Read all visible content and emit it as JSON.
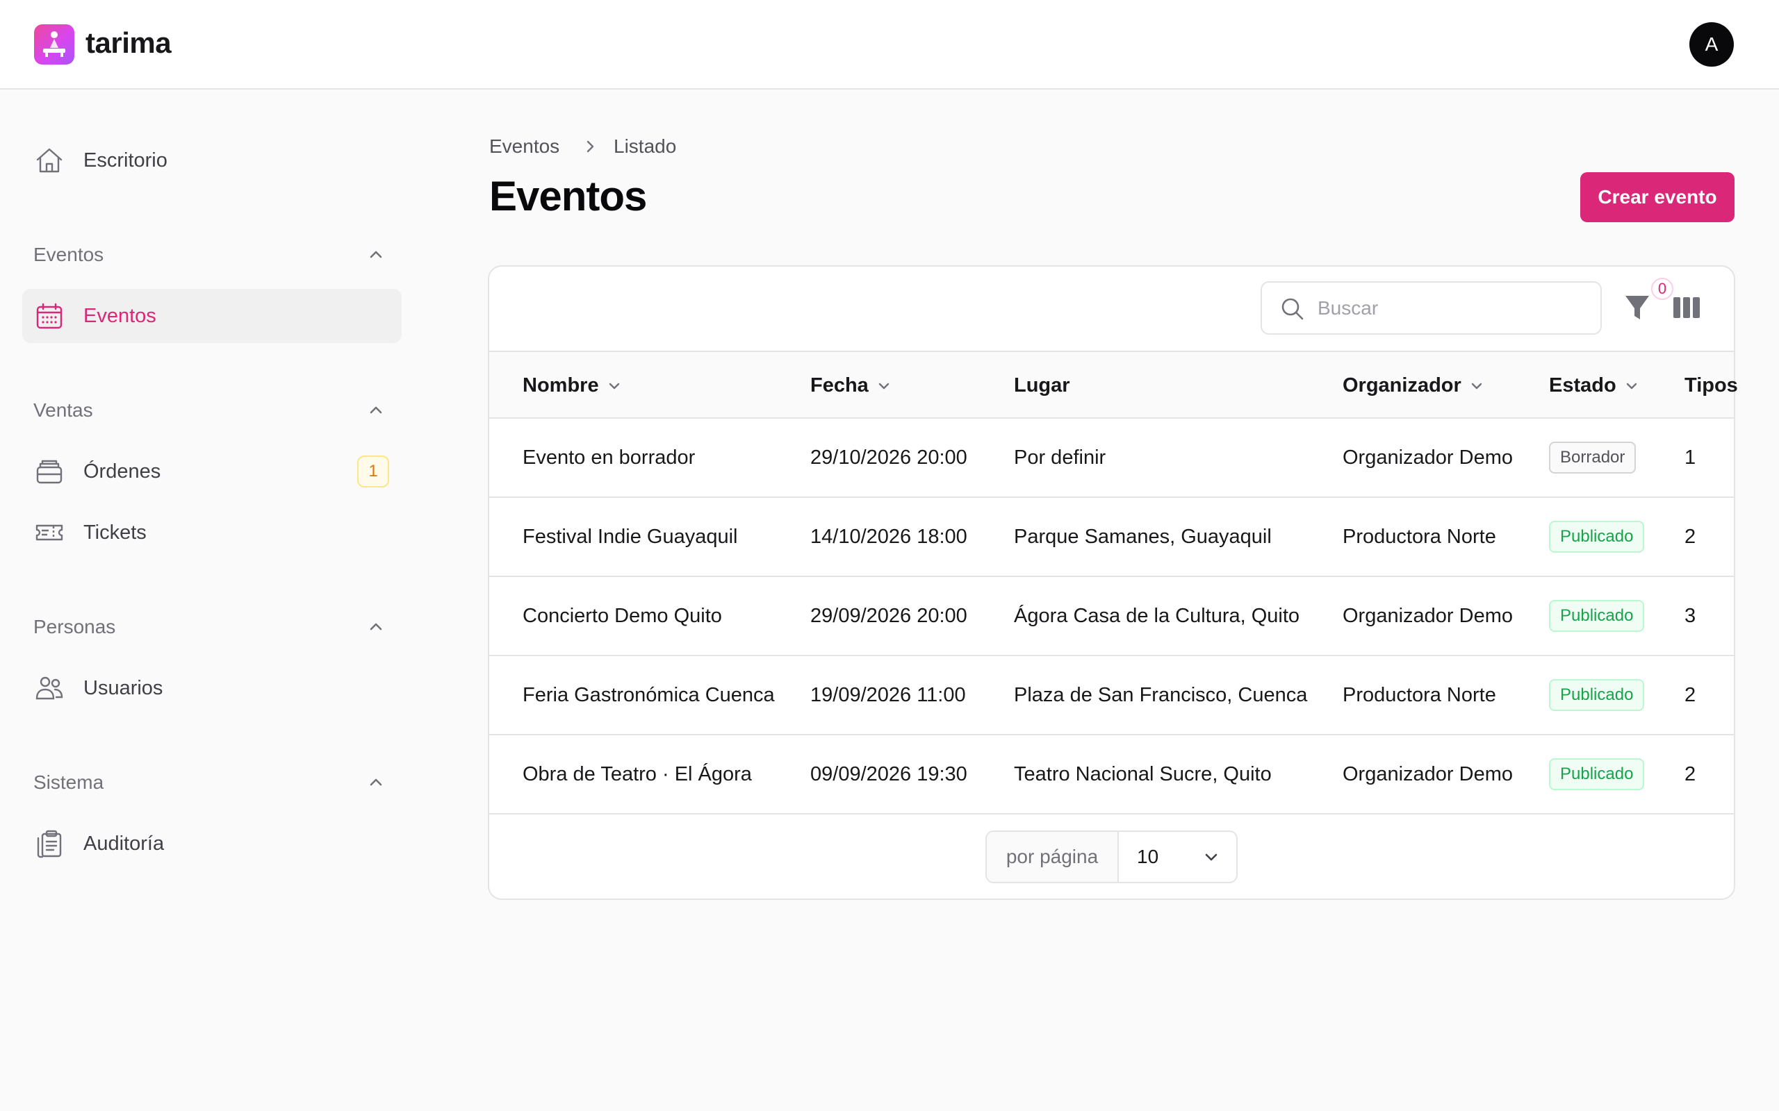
{
  "app": {
    "brand": "tarima",
    "avatar_initial": "A",
    "accent_color": "#db2777"
  },
  "sidebar": {
    "home": {
      "label": "Escritorio",
      "icon": "home-icon"
    },
    "groups": [
      {
        "label": "Eventos",
        "items": [
          {
            "label": "Eventos",
            "icon": "calendar-icon",
            "active": true
          }
        ]
      },
      {
        "label": "Ventas",
        "items": [
          {
            "label": "Órdenes",
            "icon": "inbox-icon",
            "badge": "1"
          },
          {
            "label": "Tickets",
            "icon": "ticket-icon"
          }
        ]
      },
      {
        "label": "Personas",
        "items": [
          {
            "label": "Usuarios",
            "icon": "users-icon"
          }
        ]
      },
      {
        "label": "Sistema",
        "items": [
          {
            "label": "Auditoría",
            "icon": "clipboard-icon"
          }
        ]
      }
    ]
  },
  "breadcrumb": [
    "Eventos",
    "Listado"
  ],
  "page": {
    "title": "Eventos",
    "create_label": "Crear evento"
  },
  "toolbar": {
    "search_placeholder": "Buscar",
    "search_value": "",
    "filter_count": "0"
  },
  "table": {
    "columns": [
      "Nombre",
      "Fecha",
      "Lugar",
      "Organizador",
      "Estado",
      "Tipos"
    ],
    "rows": [
      {
        "nombre": "Evento en borrador",
        "fecha": "29/10/2026 20:00",
        "lugar": "Por definir",
        "organizador": "Organizador Demo",
        "estado": "Borrador",
        "tipos": "1"
      },
      {
        "nombre": "Festival Indie Guayaquil",
        "fecha": "14/10/2026 18:00",
        "lugar": "Parque Samanes, Guayaquil",
        "organizador": "Productora Norte",
        "estado": "Publicado",
        "tipos": "2"
      },
      {
        "nombre": "Concierto Demo Quito",
        "fecha": "29/09/2026 20:00",
        "lugar": "Ágora Casa de la Cultura, Quito",
        "organizador": "Organizador Demo",
        "estado": "Publicado",
        "tipos": "3"
      },
      {
        "nombre": "Feria Gastronómica Cuenca",
        "fecha": "19/09/2026 11:00",
        "lugar": "Plaza de San Francisco, Cuenca",
        "organizador": "Productora Norte",
        "estado": "Publicado",
        "tipos": "2"
      },
      {
        "nombre": "Obra de Teatro · El Ágora",
        "fecha": "09/09/2026 19:30",
        "lugar": "Teatro Nacional Sucre, Quito",
        "organizador": "Organizador Demo",
        "estado": "Publicado",
        "tipos": "2"
      }
    ]
  },
  "pagination": {
    "per_page_label": "por página",
    "per_page_value": "10"
  }
}
